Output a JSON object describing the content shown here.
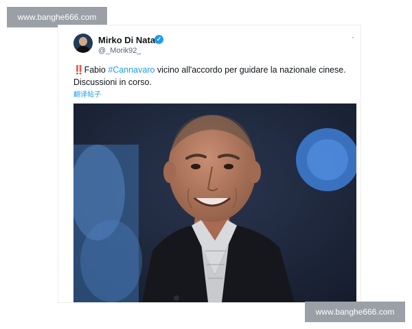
{
  "watermark": {
    "top_text": "www.banghe666.com",
    "bottom_text": "www.banghe666.com"
  },
  "tweet": {
    "author_name": "Mirko Di Natale",
    "handle": "@_Morik92_",
    "verified_icon": "verified-badge-icon",
    "more_icon": "more-icon",
    "prefix_emoji": "‼️",
    "text_before": "Fabio ",
    "hashtag": "#Cannavaro",
    "text_after": " vicino all'accordo per guidare la nazionale cinese. Discussioni in corso.",
    "translate_link": "翻译帖子"
  },
  "colors": {
    "accent": "#1d9bf0",
    "text": "#0f1419",
    "muted": "#536471",
    "watermark_bg": "#9aa0a6"
  }
}
